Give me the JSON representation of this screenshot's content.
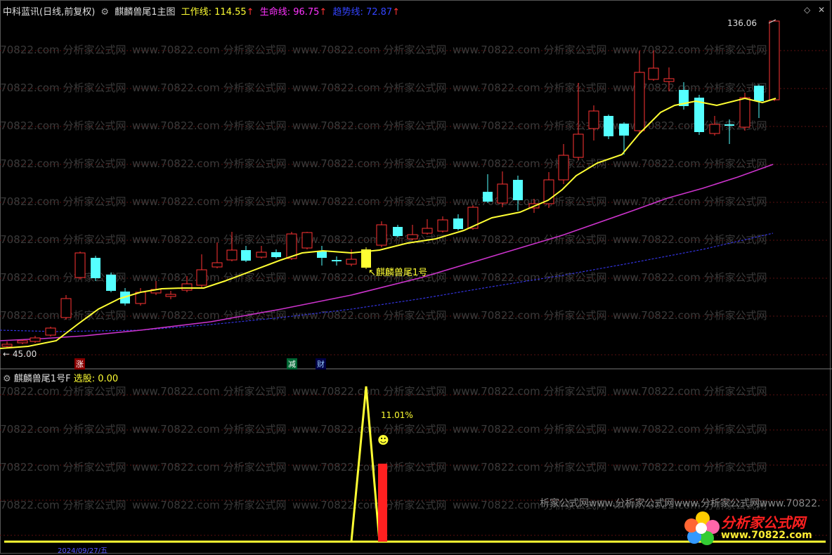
{
  "header": {
    "title": "中科蓝讯(日线,前复权)",
    "indicator": "麒麟兽尾1主图",
    "work_label": "工作线: 114.55",
    "life_label": "生命线: 96.75",
    "trend_label": "趋势线: 72.87",
    "arrow": "↑"
  },
  "price": {
    "high_label": "136.06",
    "low_label": "45.00"
  },
  "signals": {
    "zhang": "涨",
    "jian": "减",
    "cai": "财",
    "annotation": "麒麟兽尾1号"
  },
  "sub": {
    "title": "麒麟兽尾1号F",
    "select_label": "选股: 0.00",
    "pct": "11.01%",
    "date_stub": "2024/09/27/五"
  },
  "watermark": {
    "text": "www.70822.com 分析家公式网",
    "bottom_text": "析家公式网www.分析家公式网www.分析家公式网www.70822."
  },
  "logo": {
    "name": "分析家公式网",
    "url": "www.70822.com"
  },
  "colors": {
    "up": "#ff3333",
    "down": "#55ffff",
    "work": "#ffff33",
    "life": "#cc33cc",
    "trend": "#3333ff"
  }
}
